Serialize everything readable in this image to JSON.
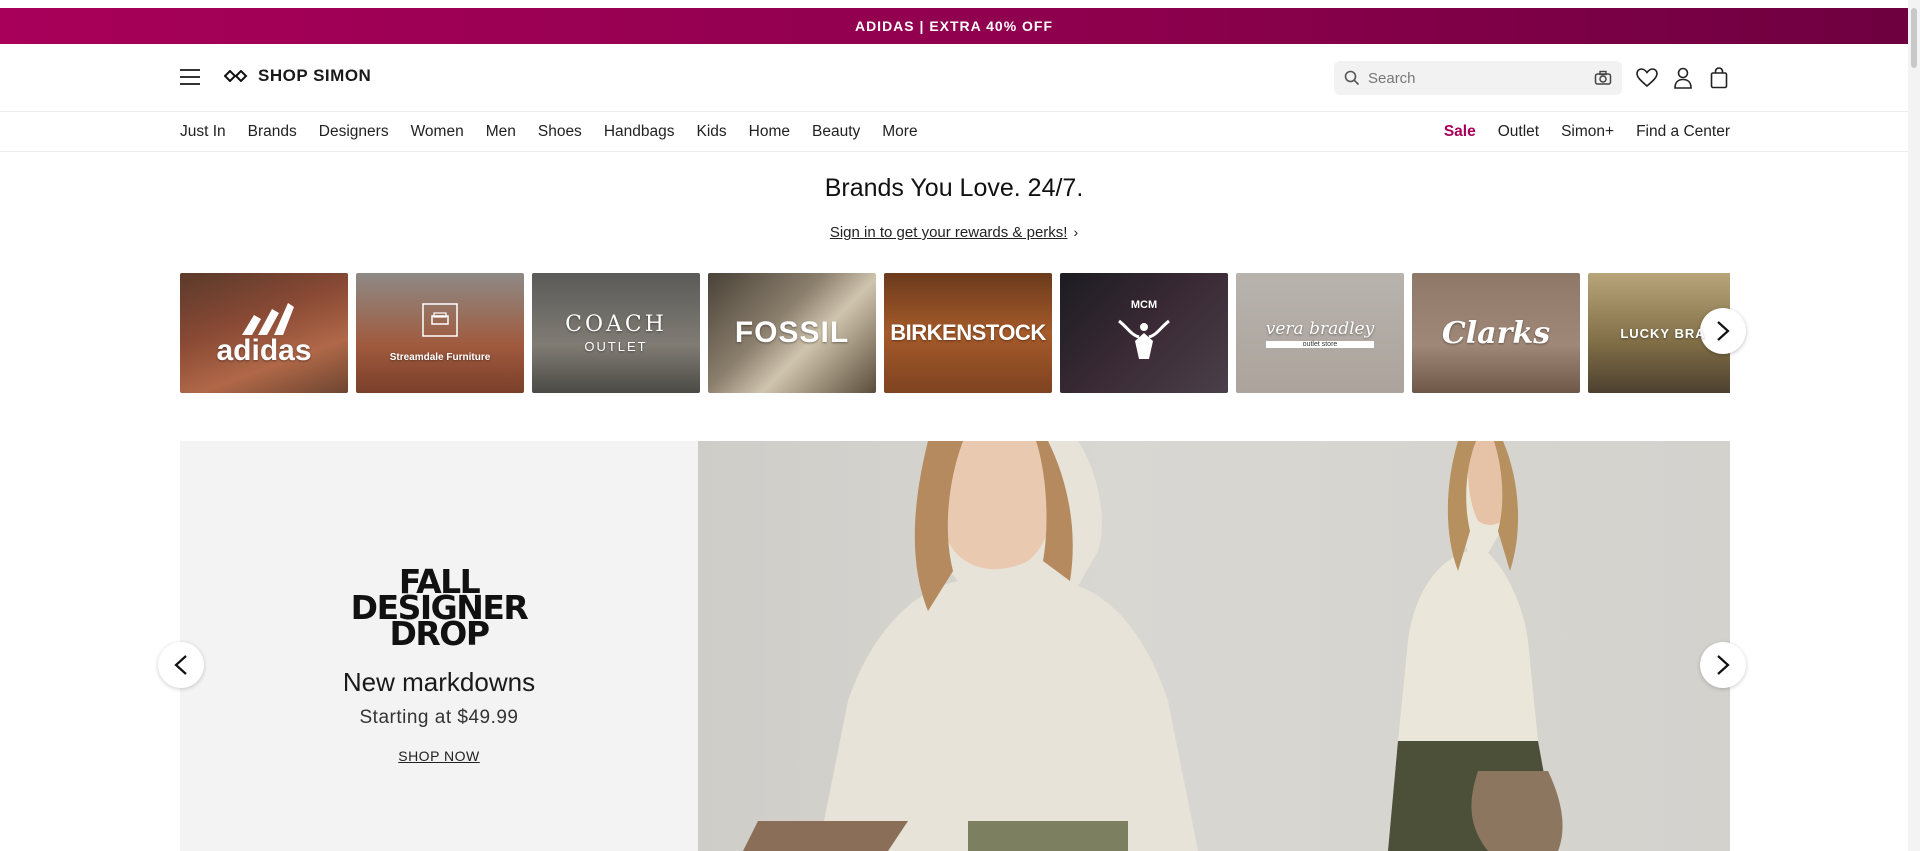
{
  "promo": {
    "text": "ADIDAS | EXTRA 40% OFF"
  },
  "header": {
    "logo_text": "SHOP SIMON",
    "search_placeholder": "Search",
    "icons": [
      "menu-icon",
      "search-icon",
      "camera-icon",
      "heart-icon",
      "user-icon",
      "bag-icon"
    ]
  },
  "nav": {
    "left": [
      "Just In",
      "Brands",
      "Designers",
      "Women",
      "Men",
      "Shoes",
      "Handbags",
      "Kids",
      "Home",
      "Beauty",
      "More"
    ],
    "right": [
      "Sale",
      "Outlet",
      "Simon+",
      "Find a Center"
    ],
    "sale_color": "#a8005a"
  },
  "hero": {
    "title": "Brands You Love. 24/7.",
    "signin": "Sign in to get your rewards & perks!"
  },
  "brands": [
    {
      "name": "adidas"
    },
    {
      "name": "Streamdale Furniture"
    },
    {
      "name": "COACH",
      "sub": "OUTLET"
    },
    {
      "name": "FOSSIL"
    },
    {
      "name": "BIRKENSTOCK"
    },
    {
      "name": "MCM"
    },
    {
      "name": "vera bradley",
      "sub": "outlet store"
    },
    {
      "name": "Clarks"
    },
    {
      "name": "LUCKY BRA"
    }
  ],
  "banner": {
    "headline": [
      "FALL",
      "DESIGNER",
      "DROP"
    ],
    "subhead": "New markdowns",
    "price": "Starting at $49.99",
    "cta": "SHOP NOW"
  },
  "colors": {
    "promo_bg": "#a8005a",
    "accent": "#a8005a"
  }
}
